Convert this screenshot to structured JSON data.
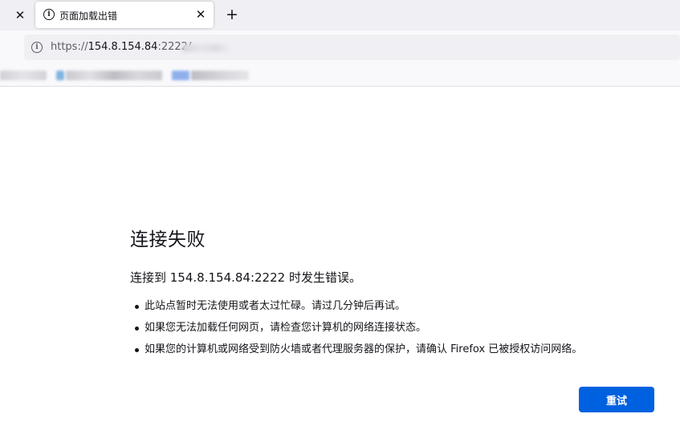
{
  "tabs": {
    "active_title": "页面加载出错",
    "new_tab_symbol": "+"
  },
  "urlbar": {
    "scheme": "https://",
    "host": "154.8.154.84",
    "port_path": ":2222/"
  },
  "error": {
    "title": "连接失败",
    "description": "连接到 154.8.154.84:2222 时发生错误。",
    "reasons": [
      "此站点暂时无法使用或者太过忙碌。请过几分钟后再试。",
      "如果您无法加载任何网页，请检查您计算机的网络连接状态。",
      "如果您的计算机或网络受到防火墙或者代理服务器的保护，请确认 Firefox 已被授权访问网络。"
    ],
    "retry_label": "重试"
  },
  "icons": {
    "info": "info-icon",
    "close": "close-icon",
    "new_tab": "plus-icon"
  },
  "colors": {
    "accent": "#0061e0",
    "text": "#15141a",
    "chrome": "#f0f0f4"
  }
}
